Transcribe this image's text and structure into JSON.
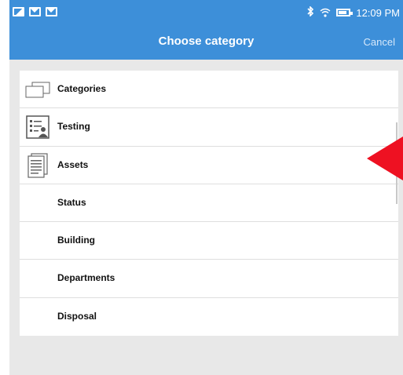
{
  "status_bar": {
    "time": "12:09 PM",
    "left_icons": [
      "photo-icon",
      "mail-icon",
      "mail-icon"
    ],
    "right_icons": [
      "bluetooth-icon",
      "wifi-icon",
      "battery-icon"
    ],
    "bluetooth_glyph": "∦"
  },
  "app_bar": {
    "title": "Choose category",
    "cancel_label": "Cancel",
    "color": "#3d8fd9"
  },
  "categories": [
    {
      "label": "Categories",
      "icon": "folders-icon"
    },
    {
      "label": "Testing",
      "icon": "checklist-icon"
    },
    {
      "label": "Assets",
      "icon": "document-icon"
    },
    {
      "label": "Status",
      "icon": ""
    },
    {
      "label": "Building",
      "icon": ""
    },
    {
      "label": "Departments",
      "icon": ""
    },
    {
      "label": "Disposal",
      "icon": ""
    }
  ],
  "annotation": {
    "arrow_color": "#ee1122",
    "points_to": "Assets"
  }
}
